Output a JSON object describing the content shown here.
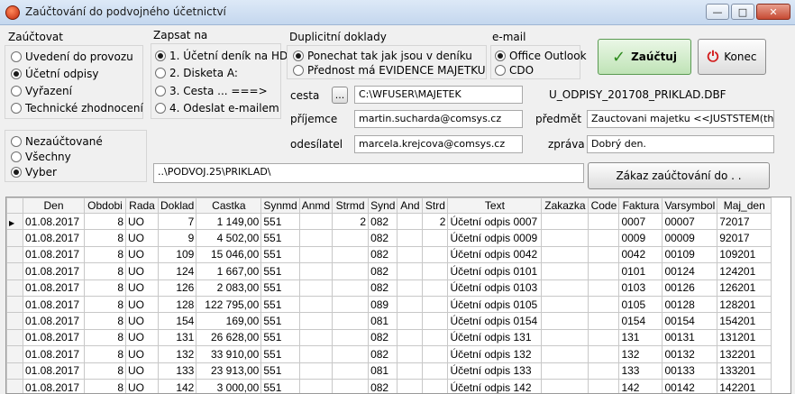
{
  "window": {
    "title": "Zaúčtování do podvojného účetnictví",
    "minimize": "—",
    "maximize": "□",
    "close": "✕"
  },
  "zauctovat": {
    "title": "Zaúčtovat",
    "options": [
      "Uvedení do provozu",
      "Účetní odpisy",
      "Vyřazení",
      "Technické zhodnocení"
    ],
    "selected": 1
  },
  "filter": {
    "options": [
      "Nezaúčtované",
      "Všechny",
      "Vyber"
    ],
    "selected": 2
  },
  "zapsat": {
    "title": "Zapsat na",
    "options": [
      "1. Účetní deník na HD",
      "2. Disketa A:",
      "3. Cesta ... ===>",
      "4. Odeslat e-mailem"
    ],
    "selected": 0
  },
  "duplicity": {
    "title": "Duplicitní doklady",
    "options": [
      "Ponechat tak jak jsou v deníku",
      "Přednost má EVIDENCE MAJETKU"
    ],
    "selected": 0
  },
  "email": {
    "title": "e-mail",
    "options": [
      "Office Outlook",
      "CDO"
    ],
    "selected": 0
  },
  "buttons": {
    "post": "Zaúčtuj",
    "end": "Konec",
    "browse": "...",
    "block": "Zákaz zaúčtování do  . ."
  },
  "fields": {
    "cesta_label": "cesta",
    "cesta_value": "C:\\WFUSER\\MAJETEK",
    "prijemce_label": "příjemce",
    "prijemce_value": "martin.sucharda@comsys.cz",
    "odesilatel_label": "odesílatel",
    "odesilatel_value": "marcela.krejcova@comsys.cz",
    "predmet_label": "předmět",
    "predmet_value": "Zauctovani majetku <<JUSTSTEM(th",
    "zprava_label": "zpráva",
    "zprava_value": "Dobrý den.",
    "filename": "U_ODPISY_201708_PRIKLAD.DBF",
    "path_value": "..\\PODVOJ.25\\PRIKLAD\\"
  },
  "table": {
    "columns": [
      "Den",
      "Obdobi",
      "Rada",
      "Doklad",
      "Castka",
      "Synmd",
      "Anmd",
      "Strmd",
      "Synd",
      "And",
      "Strd",
      "Text",
      "Zakazka",
      "Code",
      "Faktura",
      "Varsymbol",
      "Maj_den"
    ],
    "rows": [
      [
        "01.08.2017",
        "8",
        "UO",
        "7",
        "1 149,00",
        "551",
        "",
        "2",
        "082",
        "",
        "2",
        "Účetní odpis 0007",
        "",
        "",
        "0007",
        "00007",
        "72017"
      ],
      [
        "01.08.2017",
        "8",
        "UO",
        "9",
        "4 502,00",
        "551",
        "",
        "",
        "082",
        "",
        "",
        "Účetní odpis 0009",
        "",
        "",
        "0009",
        "00009",
        "92017"
      ],
      [
        "01.08.2017",
        "8",
        "UO",
        "109",
        "15 046,00",
        "551",
        "",
        "",
        "082",
        "",
        "",
        "Účetní odpis 0042",
        "",
        "",
        "0042",
        "00109",
        "109201"
      ],
      [
        "01.08.2017",
        "8",
        "UO",
        "124",
        "1 667,00",
        "551",
        "",
        "",
        "082",
        "",
        "",
        "Účetní odpis 0101",
        "",
        "",
        "0101",
        "00124",
        "124201"
      ],
      [
        "01.08.2017",
        "8",
        "UO",
        "126",
        "2 083,00",
        "551",
        "",
        "",
        "082",
        "",
        "",
        "Účetní odpis 0103",
        "",
        "",
        "0103",
        "00126",
        "126201"
      ],
      [
        "01.08.2017",
        "8",
        "UO",
        "128",
        "122 795,00",
        "551",
        "",
        "",
        "089",
        "",
        "",
        "Účetní odpis 0105",
        "",
        "",
        "0105",
        "00128",
        "128201"
      ],
      [
        "01.08.2017",
        "8",
        "UO",
        "154",
        "169,00",
        "551",
        "",
        "",
        "081",
        "",
        "",
        "Účetní odpis 0154",
        "",
        "",
        "0154",
        "00154",
        "154201"
      ],
      [
        "01.08.2017",
        "8",
        "UO",
        "131",
        "26 628,00",
        "551",
        "",
        "",
        "082",
        "",
        "",
        "Účetní odpis 131",
        "",
        "",
        "131",
        "00131",
        "131201"
      ],
      [
        "01.08.2017",
        "8",
        "UO",
        "132",
        "33 910,00",
        "551",
        "",
        "",
        "082",
        "",
        "",
        "Účetní odpis 132",
        "",
        "",
        "132",
        "00132",
        "132201"
      ],
      [
        "01.08.2017",
        "8",
        "UO",
        "133",
        "23 913,00",
        "551",
        "",
        "",
        "081",
        "",
        "",
        "Účetní odpis 133",
        "",
        "",
        "133",
        "00133",
        "133201"
      ],
      [
        "01.08.2017",
        "8",
        "UO",
        "142",
        "3 000,00",
        "551",
        "",
        "",
        "082",
        "",
        "",
        "Účetní odpis 142",
        "",
        "",
        "142",
        "00142",
        "142201"
      ]
    ],
    "current_row": 0
  }
}
